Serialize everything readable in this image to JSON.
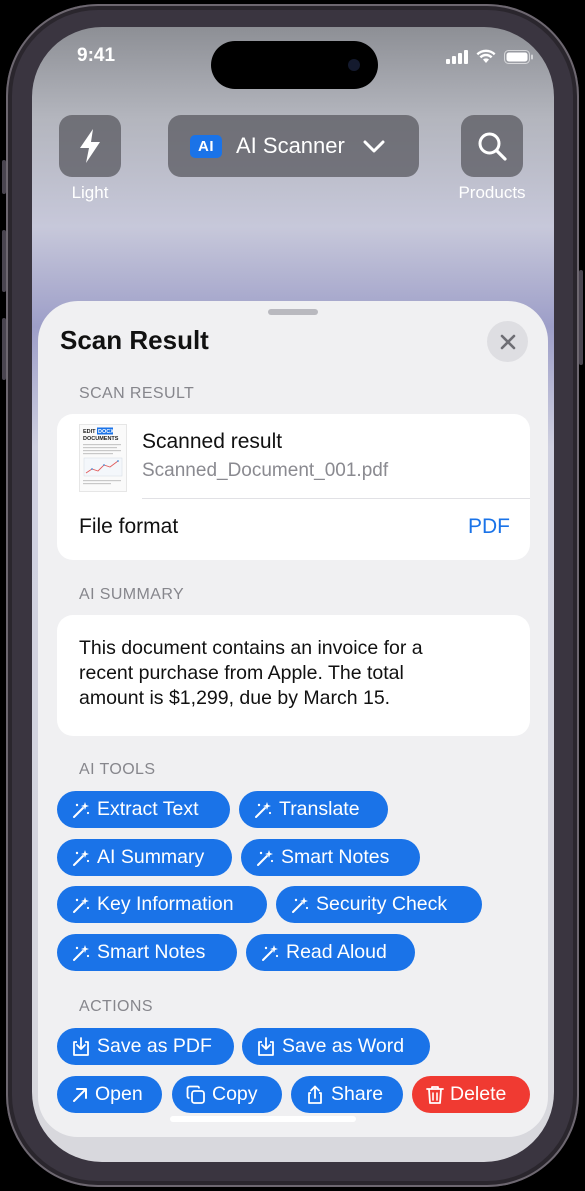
{
  "status": {
    "time": "9:41"
  },
  "top": {
    "light_label": "Light",
    "scanner_chip": "AI",
    "scanner_label": "AI Scanner",
    "products_label": "Products"
  },
  "sheet": {
    "title": "Scan Result",
    "scan_result_header": "SCAN RESULT",
    "result_title": "Scanned result",
    "result_file": "Scanned_Document_001.pdf",
    "thumb_text": [
      "EDIT",
      "DOCX",
      "DOCUMENTS"
    ],
    "file_format_label": "File format",
    "file_format_value": "PDF",
    "ai_summary_header": "AI SUMMARY",
    "summary_lines": [
      "This document contains an invoice for a",
      "recent purchase from Apple. The total",
      "amount is $1,299, due by March 15."
    ],
    "ai_tools_header": "AI TOOLS",
    "tools": [
      "Extract Text",
      "Translate",
      "AI Summary",
      "Smart Notes",
      "Key Information",
      "Security Check",
      "Smart Notes",
      "Read Aloud"
    ],
    "actions_header": "ACTIONS",
    "actions": [
      "Save as PDF",
      "Save as Word",
      "Open",
      "Copy",
      "Share",
      "Delete"
    ]
  },
  "colors": {
    "accent": "#1a73e8",
    "danger": "#f03a32",
    "sheet_bg": "#f0f0f2"
  }
}
